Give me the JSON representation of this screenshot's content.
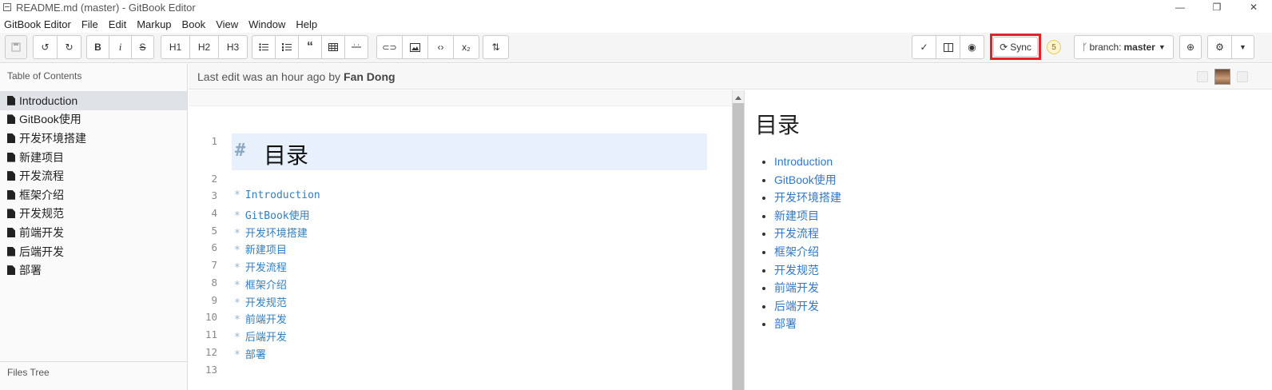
{
  "window": {
    "title": "README.md (master) - GitBook Editor",
    "controls": [
      "—",
      "❐",
      "✕"
    ]
  },
  "menu": [
    "GitBook Editor",
    "File",
    "Edit",
    "Markup",
    "Book",
    "View",
    "Window",
    "Help"
  ],
  "toolbar": {
    "h1": "H1",
    "h2": "H2",
    "h3": "H3",
    "bold": "B",
    "italic": "i",
    "strike": "S",
    "sync_label": "Sync",
    "sync_count": "5",
    "branch_prefix": "branch:",
    "branch_name": "master"
  },
  "sidebar": {
    "toc_title": "Table of Contents",
    "items": [
      {
        "label": "Introduction"
      },
      {
        "label": "GitBook使用"
      },
      {
        "label": "开发环境搭建"
      },
      {
        "label": "新建项目"
      },
      {
        "label": "开发流程"
      },
      {
        "label": "框架介绍"
      },
      {
        "label": "开发规范"
      },
      {
        "label": "前端开发"
      },
      {
        "label": "后端开发"
      },
      {
        "label": "部署"
      }
    ],
    "files_title": "Files Tree"
  },
  "info": {
    "last_edit": "Last edit was an hour ago by",
    "author": "Fan Dong"
  },
  "editor": {
    "heading_hash": "#",
    "heading_text": "目录",
    "line_numbers": [
      "1",
      "2",
      "3",
      "4",
      "5",
      "6",
      "7",
      "8",
      "9",
      "10",
      "11",
      "12",
      "13"
    ],
    "list_marker": "*",
    "list_items": [
      "Introduction",
      "GitBook使用",
      "开发环境搭建",
      "新建项目",
      "开发流程",
      "框架介绍",
      "开发规范",
      "前端开发",
      "后端开发",
      "部署"
    ]
  },
  "preview": {
    "title": "目录",
    "items": [
      "Introduction",
      "GitBook使用",
      "开发环境搭建",
      "新建项目",
      "开发流程",
      "框架介绍",
      "开发规范",
      "前端开发",
      "后端开发",
      "部署"
    ]
  },
  "colors": {
    "link": "#3178c6",
    "sync_highlight": "#e8202a",
    "badge_bg": "#fcf4d2"
  }
}
